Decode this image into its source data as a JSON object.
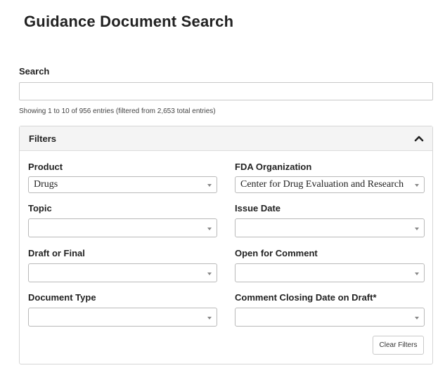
{
  "page": {
    "title": "Guidance Document Search"
  },
  "search": {
    "label": "Search",
    "value": "",
    "placeholder": ""
  },
  "entries_info": "Showing 1 to 10 of 956 entries (filtered from 2,653 total entries)",
  "filters": {
    "title": "Filters",
    "toggle_icon": "chevron-up-icon",
    "fields": {
      "product": {
        "label": "Product",
        "value": "Drugs"
      },
      "fda_organization": {
        "label": "FDA Organization",
        "value": "Center for Drug Evaluation and Research"
      },
      "topic": {
        "label": "Topic",
        "value": ""
      },
      "issue_date": {
        "label": "Issue Date",
        "value": ""
      },
      "draft_or_final": {
        "label": "Draft or Final",
        "value": ""
      },
      "open_for_comment": {
        "label": "Open for Comment",
        "value": ""
      },
      "document_type": {
        "label": "Document Type",
        "value": ""
      },
      "comment_closing_date": {
        "label": "Comment Closing Date on Draft*",
        "value": ""
      }
    },
    "clear_label": "Clear Filters"
  }
}
